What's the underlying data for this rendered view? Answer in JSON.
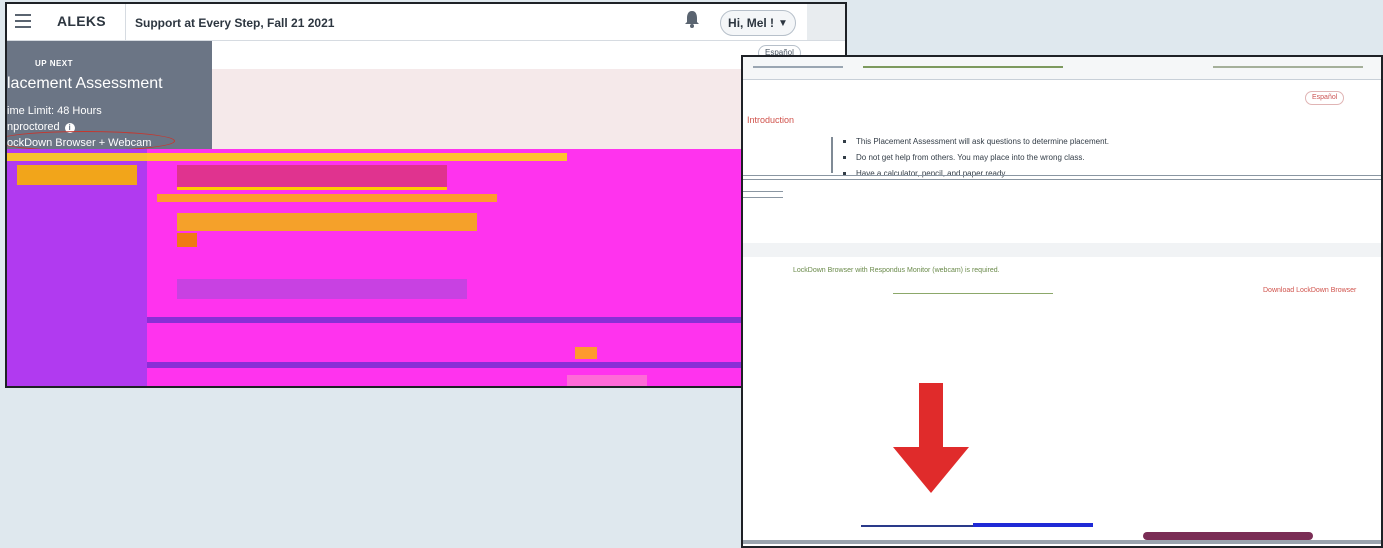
{
  "left_window": {
    "header": {
      "logo": "ALEKS",
      "class_title": "Support at Every Step, Fall 21 2021",
      "user_button": "Hi, Mel !"
    },
    "sidebar": {
      "up_next": "UP NEXT",
      "title": "lacement Assessment",
      "time_limit": "ime Limit: 48 Hours",
      "proctoring": "nproctored",
      "lockdown": "ockDown Browser + Webcam"
    },
    "language_button": "Español"
  },
  "right_window": {
    "language_button": "Español",
    "intro_heading": "Introduction",
    "bullets": [
      "This Placement Assessment will ask questions to determine placement.",
      "Do not get help from others. You may place into the wrong class.",
      "Have a calculator, pencil, and paper ready."
    ],
    "lockdown_required": "LockDown Browser with Respondus Monitor (webcam) is required.",
    "download_link": "Download LockDown Browser"
  },
  "colors": {
    "arrow": "#e02b2b",
    "accent_pink": "#d0524b",
    "sidebar_bg": "#6b7585"
  },
  "icons": {
    "menu": "hamburger-menu-icon",
    "bell": "bell-icon",
    "chevron": "chevron-down-icon",
    "info": "info-icon",
    "arrow": "down-arrow-icon"
  }
}
